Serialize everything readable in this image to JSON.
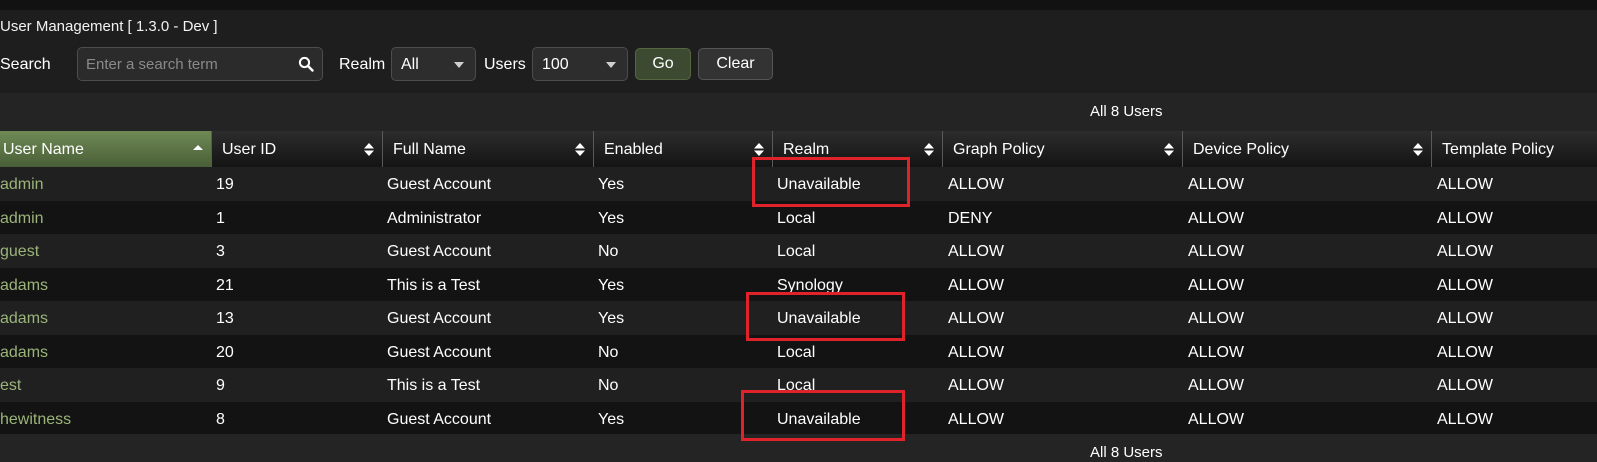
{
  "app": {
    "title": "User Management [ 1.3.0 - Dev ]"
  },
  "toolbar": {
    "search_label": "Search",
    "search_value": "",
    "search_placeholder": "Enter a search term",
    "realm_label": "Realm",
    "realm_selected": "All",
    "users_label": "Users",
    "users_selected": "100",
    "go_label": "Go",
    "clear_label": "Clear"
  },
  "summary": {
    "top_text": "All 8 Users",
    "bottom_text": "All 8 Users"
  },
  "table": {
    "columns": [
      {
        "label": "User Name",
        "sorted": "asc"
      },
      {
        "label": "User ID"
      },
      {
        "label": "Full Name"
      },
      {
        "label": "Enabled"
      },
      {
        "label": "Realm"
      },
      {
        "label": "Graph Policy"
      },
      {
        "label": "Device Policy"
      },
      {
        "label": "Template Policy"
      }
    ],
    "rows": [
      {
        "user_name": "admin",
        "user_id": "19",
        "full_name": "Guest Account",
        "enabled": "Yes",
        "realm": "Unavailable",
        "graph_policy": "ALLOW",
        "device_policy": "ALLOW",
        "template_policy": "ALLOW"
      },
      {
        "user_name": "admin",
        "user_id": "1",
        "full_name": "Administrator",
        "enabled": "Yes",
        "realm": "Local",
        "graph_policy": "DENY",
        "device_policy": "ALLOW",
        "template_policy": "ALLOW"
      },
      {
        "user_name": "guest",
        "user_id": "3",
        "full_name": "Guest Account",
        "enabled": "No",
        "realm": "Local",
        "graph_policy": "ALLOW",
        "device_policy": "ALLOW",
        "template_policy": "ALLOW"
      },
      {
        "user_name": "adams",
        "user_id": "21",
        "full_name": "This is a Test",
        "enabled": "Yes",
        "realm": "Synology",
        "graph_policy": "ALLOW",
        "device_policy": "ALLOW",
        "template_policy": "ALLOW"
      },
      {
        "user_name": "adams",
        "user_id": "13",
        "full_name": "Guest Account",
        "enabled": "Yes",
        "realm": "Unavailable",
        "graph_policy": "ALLOW",
        "device_policy": "ALLOW",
        "template_policy": "ALLOW"
      },
      {
        "user_name": "adams",
        "user_id": "20",
        "full_name": "Guest Account",
        "enabled": "No",
        "realm": "Local",
        "graph_policy": "ALLOW",
        "device_policy": "ALLOW",
        "template_policy": "ALLOW"
      },
      {
        "user_name": "est",
        "user_id": "9",
        "full_name": "This is a Test",
        "enabled": "No",
        "realm": "Local",
        "graph_policy": "ALLOW",
        "device_policy": "ALLOW",
        "template_policy": "ALLOW"
      },
      {
        "user_name": "hewitness",
        "user_id": "8",
        "full_name": "Guest Account",
        "enabled": "Yes",
        "realm": "Unavailable",
        "graph_policy": "ALLOW",
        "device_policy": "ALLOW",
        "template_policy": "ALLOW"
      }
    ]
  },
  "colors": {
    "accent_green": "#6f8a55",
    "username_green": "#9bb47a",
    "highlight_red": "#e0232b"
  }
}
